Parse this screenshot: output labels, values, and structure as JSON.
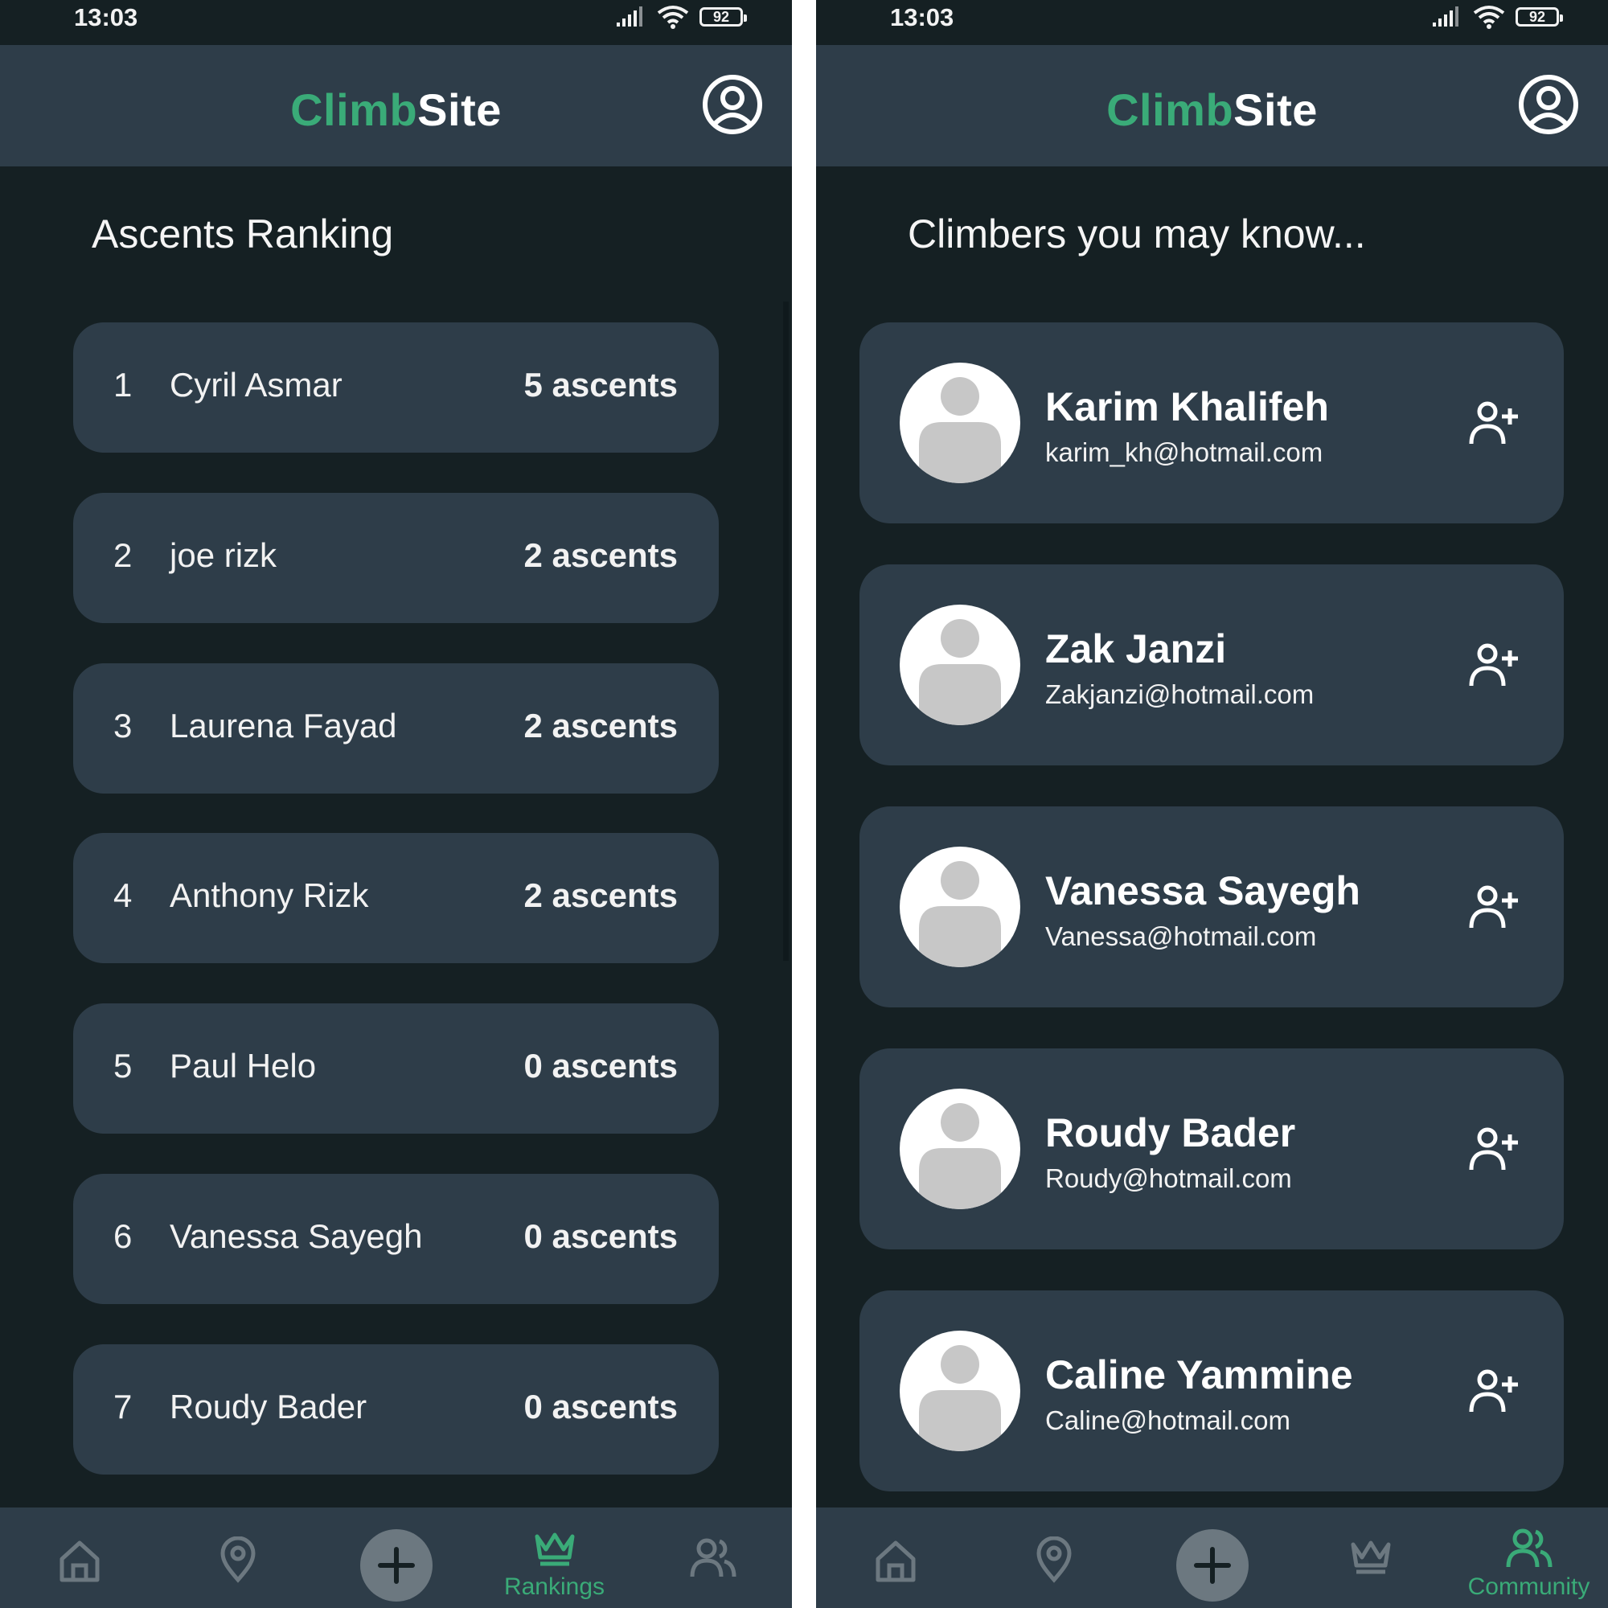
{
  "colors": {
    "background": "#152023",
    "surface": "#2e3d49",
    "accent": "#3aab78",
    "text": "#ffffff",
    "muted_icon": "#6c7880"
  },
  "status_bar": {
    "time": "13:03",
    "battery": "92"
  },
  "brand": {
    "part1": "Climb",
    "part2": "Site"
  },
  "left": {
    "title": "Ascents Ranking",
    "rankings": [
      {
        "rank": "1",
        "name": "Cyril Asmar",
        "ascents": "5 ascents"
      },
      {
        "rank": "2",
        "name": "joe rizk",
        "ascents": "2 ascents"
      },
      {
        "rank": "3",
        "name": "Laurena Fayad",
        "ascents": "2 ascents"
      },
      {
        "rank": "4",
        "name": "Anthony Rizk",
        "ascents": "2 ascents"
      },
      {
        "rank": "5",
        "name": "Paul Helo",
        "ascents": "0 ascents"
      },
      {
        "rank": "6",
        "name": "Vanessa Sayegh",
        "ascents": "0 ascents"
      },
      {
        "rank": "7",
        "name": "Roudy Bader",
        "ascents": "0 ascents"
      }
    ],
    "nav_active_label": "Rankings"
  },
  "right": {
    "title": "Climbers you may know...",
    "people": [
      {
        "name": "Karim Khalifeh",
        "email": "karim_kh@hotmail.com"
      },
      {
        "name": "Zak Janzi",
        "email": "Zakjanzi@hotmail.com"
      },
      {
        "name": "Vanessa Sayegh",
        "email": "Vanessa@hotmail.com"
      },
      {
        "name": "Roudy Bader",
        "email": "Roudy@hotmail.com"
      },
      {
        "name": "Caline Yammine",
        "email": "Caline@hotmail.com"
      }
    ],
    "nav_active_label": "Community"
  },
  "nav_icons": [
    "home-icon",
    "location-pin-icon",
    "plus-icon",
    "crown-icon",
    "users-icon"
  ]
}
